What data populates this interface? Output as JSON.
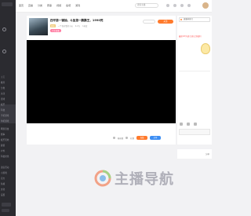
{
  "topbar": {
    "nav": [
      "首页",
      "直播",
      "分类",
      "赛事",
      "视频",
      "鱼吧",
      "游戏"
    ],
    "search_placeholder": "搜索主播"
  },
  "sidebar": {
    "labels": [
      "主页",
      "推荐",
      "分类",
      "关注",
      "游戏",
      "娱乐",
      "科技",
      "手机游戏",
      "单机游戏",
      "网游竞技",
      "赛事",
      "娱乐天地",
      "颜值",
      "户外",
      "科技文化",
      "语音互动",
      "小游戏",
      "官方",
      "鱼塘",
      "文化",
      "设置"
    ]
  },
  "room": {
    "title": "四平第一铺抽，斗鱼第一鹏鹏王，1990死",
    "tag": "颜值",
    "meta_1": "一个喜欢看的小伙",
    "meta_2": "4.2万",
    "meta_3": "1热度",
    "category_badge": "户外直播",
    "follow_label": "关注",
    "controls": {
      "fans_label": "粉丝团",
      "gift_label": "礼物",
      "recharge_label": "充值",
      "share_label": "分享"
    }
  },
  "right_panel": {
    "rank_label": "直播间排行",
    "tip": "最新VIP开通 注册立领福利",
    "below_label": "分享"
  },
  "watermark": {
    "text": "主播导航"
  },
  "colors": {
    "accent": "#ff7a2c",
    "blue": "#3d8ef3",
    "sidebar": "#2b2b30",
    "player": "#000000"
  }
}
